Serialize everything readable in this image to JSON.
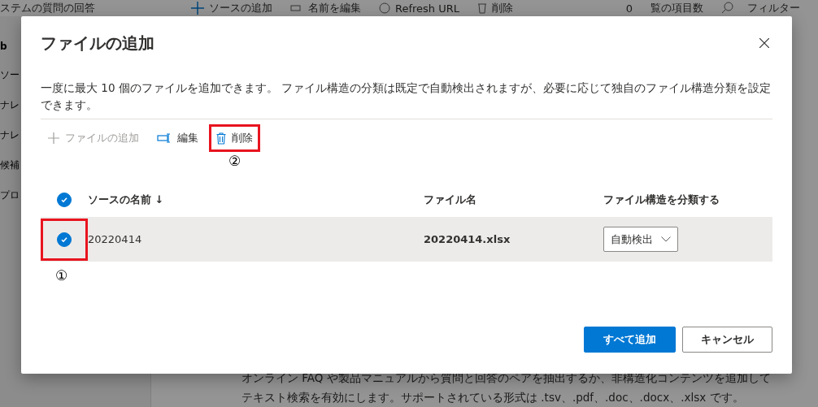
{
  "background": {
    "title": "ステムの質問の回答",
    "toolbar": [
      {
        "kind": "plus",
        "label": "ソースの追加"
      },
      {
        "kind": "rename",
        "label": "名前を編集"
      },
      {
        "kind": "refresh",
        "label": "Refresh URL"
      },
      {
        "kind": "trash",
        "label": "削除"
      }
    ],
    "item_count": "0",
    "count_label": "覧の項目数",
    "filter": "フィルター",
    "sidebar": [
      "b",
      "ソー",
      "ナレ",
      "ナレ",
      "候補",
      "プロ"
    ],
    "description": [
      "オンライン FAQ や製品マニュアルから質問と回答のペアを抽出するか、非構造化コンテンツを追加して",
      "テキスト検索を有効にします。サポートされている形式は .tsv、.pdf、.doc、.docx、.xlsx です。"
    ]
  },
  "dialog": {
    "title": "ファイルの追加",
    "description": "一度に最大 10 個のファイルを追加できます。 ファイル構造の分類は既定で自動検出されますが、必要に応じて独自のファイル構造分類を設定できます。",
    "toolbar": [
      {
        "kind": "add",
        "label": "ファイルの追加",
        "disabled": true,
        "highlighted": false
      },
      {
        "kind": "edit",
        "label": "編集",
        "disabled": false,
        "highlighted": false
      },
      {
        "kind": "delete",
        "label": "削除",
        "disabled": false,
        "highlighted": true,
        "annotation": "②"
      }
    ],
    "table": {
      "all_checked": true,
      "columns": [
        "ソースの名前 ↓",
        "ファイル名",
        "ファイル構造を分類する"
      ],
      "rows": [
        {
          "checked": true,
          "highlighted": true,
          "annotation": "①",
          "name": "20220414",
          "file": "20220414.xlsx",
          "classification": "自動検出"
        }
      ]
    },
    "buttons": [
      {
        "kind": "primary",
        "label": "すべて追加"
      },
      {
        "kind": "default",
        "label": "キャンセル"
      }
    ]
  }
}
